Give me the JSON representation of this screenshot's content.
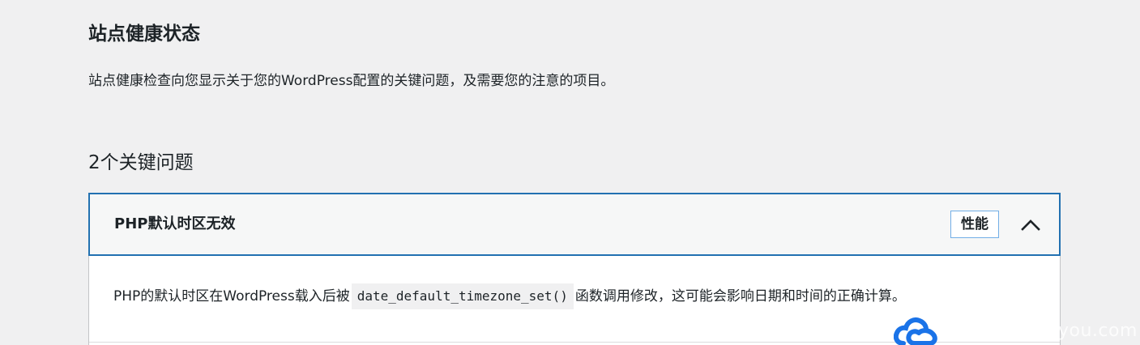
{
  "header": {
    "title": "站点健康状态",
    "description": "站点健康检查向您显示关于您的WordPress配置的关键问题，及需要您的注意的项目。"
  },
  "issues": {
    "count_label": "2个关键问题",
    "items": [
      {
        "title": "PHP默认时区无效",
        "badge": "性能",
        "expanded": true,
        "body_before": "PHP的默认时区在WordPress载入后被",
        "body_code": "date_default_timezone_set()",
        "body_after": "函数调用修改，这可能会影响日期和时间的正确计算。"
      }
    ]
  },
  "watermark": {
    "text": "you.com"
  },
  "colors": {
    "accent": "#2271b1",
    "badge_border": "#72aee6",
    "background": "#f0f0f1",
    "logo_blue": "#1a73e8"
  },
  "icons": {
    "toggle": "chevron-up-icon",
    "logo": "cloud-logo-icon"
  }
}
